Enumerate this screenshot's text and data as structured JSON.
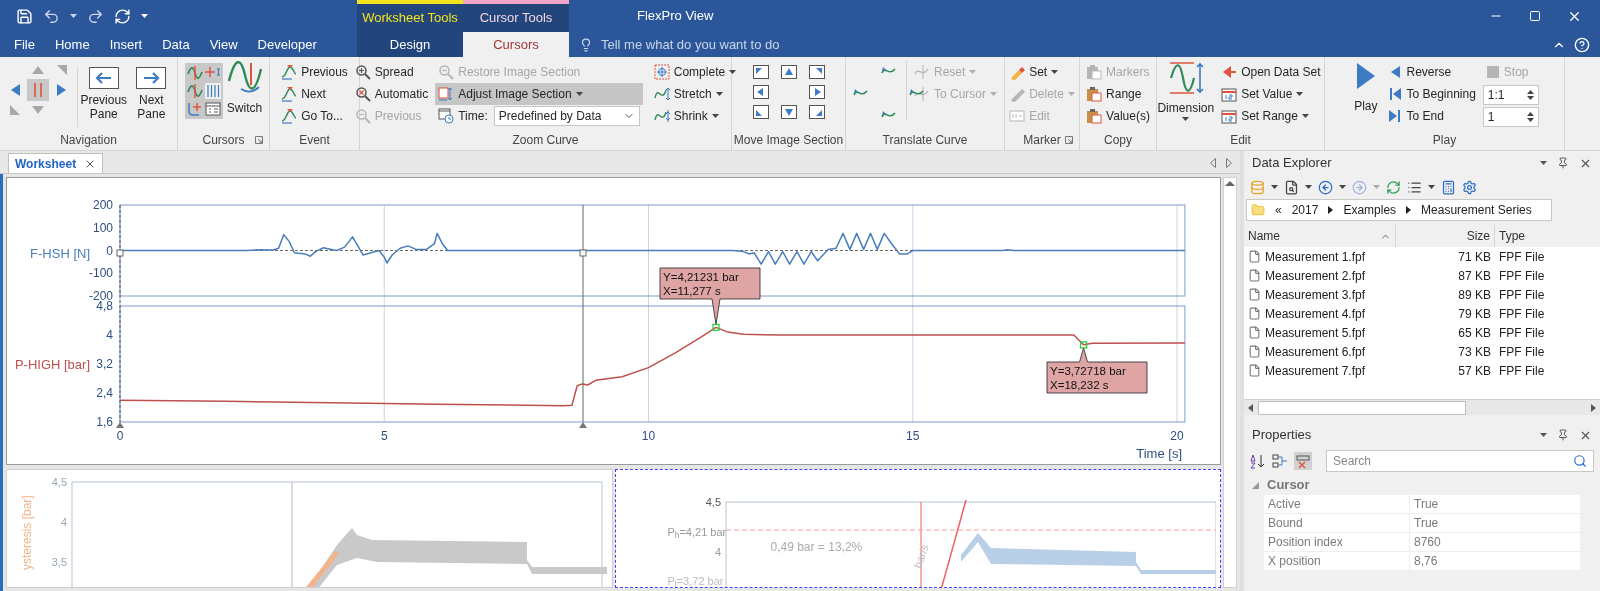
{
  "title_bar": {
    "title": "FlexPro View"
  },
  "menu_tabs": [
    {
      "label": "File",
      "selected": false
    },
    {
      "label": "Home",
      "selected": false
    },
    {
      "label": "Insert",
      "selected": false
    },
    {
      "label": "Data",
      "selected": false
    },
    {
      "label": "View",
      "selected": false
    },
    {
      "label": "Developer",
      "selected": false
    }
  ],
  "context_groups": [
    {
      "label": "Worksheet Tools",
      "color": "#f4e31c",
      "tabs": [
        {
          "label": "Design",
          "selected": false
        }
      ]
    },
    {
      "label": "Cursor Tools",
      "color": "#f2a5c6",
      "tabs": [
        {
          "label": "Cursors",
          "selected": true
        }
      ]
    }
  ],
  "tell_me": {
    "placeholder": "Tell me what do you want to do"
  },
  "ribbon": {
    "navigation": {
      "label": "Navigation",
      "buttons": [
        {
          "label": "Previous Pane"
        },
        {
          "label": "Next Pane"
        }
      ]
    },
    "cursors": {
      "label": "Cursors",
      "switch": "Switch"
    },
    "event": {
      "label": "Event",
      "items": [
        {
          "label": "Previous"
        },
        {
          "label": "Next"
        },
        {
          "label": "Go To..."
        }
      ]
    },
    "zoom": {
      "label": "Zoom Curve",
      "items": [
        {
          "label": "Spread",
          "disabled": false
        },
        {
          "label": "Automatic",
          "disabled": false
        },
        {
          "label": "Previous",
          "disabled": true
        }
      ],
      "image": [
        {
          "label": "Restore Image Section",
          "disabled": true,
          "dropdown": false,
          "selected": false
        },
        {
          "label": "Adjust Image Section",
          "disabled": false,
          "dropdown": true,
          "selected": true
        }
      ],
      "time": {
        "label": "Time:",
        "value": "Predefined by Data"
      },
      "fit": [
        {
          "label": "Complete",
          "dropdown": true
        },
        {
          "label": "Stretch",
          "dropdown": true
        },
        {
          "label": "Shrink",
          "dropdown": true
        }
      ]
    },
    "move": {
      "label": "Move Image Section"
    },
    "translate": {
      "label": "Translate Curve",
      "items": [
        {
          "label": "Reset",
          "disabled": true,
          "dropdown": true
        },
        {
          "label": "To Cursor",
          "disabled": true,
          "dropdown": true
        }
      ]
    },
    "marker": {
      "label": "Marker",
      "items": [
        {
          "label": "Set",
          "disabled": false,
          "dropdown": true
        },
        {
          "label": "Delete",
          "disabled": true,
          "dropdown": true
        },
        {
          "label": "Edit",
          "disabled": true,
          "dropdown": false
        }
      ]
    },
    "copy": {
      "label": "Copy",
      "items": [
        {
          "label": "Markers",
          "disabled": true
        },
        {
          "label": "Range",
          "disabled": false
        },
        {
          "label": "Value(s)",
          "disabled": false
        }
      ]
    },
    "edit": {
      "label": "Edit",
      "dimension": "Dimension",
      "items": [
        {
          "label": "Open Data Set",
          "dropdown": false
        },
        {
          "label": "Set Value",
          "dropdown": true
        },
        {
          "label": "Set Range",
          "dropdown": true
        }
      ]
    },
    "play": {
      "label": "Play",
      "play": "Play",
      "items": [
        {
          "label": "Reverse",
          "disabled": false
        },
        {
          "label": "To Beginning",
          "disabled": false
        },
        {
          "label": "To End",
          "disabled": false
        }
      ],
      "stop": {
        "label": "Stop",
        "disabled": true
      },
      "spinners": [
        {
          "value": "1:1"
        },
        {
          "value": "1"
        }
      ]
    }
  },
  "doc_tabs": [
    {
      "label": "Worksheet",
      "selected": true
    }
  ],
  "chart": {
    "panes": [
      {
        "chart_data": {
          "type": "line",
          "ylim": [
            -200,
            200
          ],
          "yticks": [
            200,
            100,
            0,
            -100,
            -200
          ],
          "xlim": [
            0,
            20.15
          ],
          "x": [
            0,
            2.4,
            2.6,
            2.9,
            3.0,
            3.1,
            3.2,
            3.3,
            3.5,
            3.6,
            3.7,
            3.85,
            4.0,
            4.1,
            4.25,
            4.4,
            4.5,
            4.6,
            4.75,
            4.9,
            5.0,
            5.05,
            5.15,
            5.3,
            5.45,
            5.6,
            5.8,
            5.95,
            6.0,
            6.1,
            6.2,
            11.6,
            11.8,
            11.9,
            12.0,
            12.13,
            12.27,
            12.4,
            12.54,
            12.67,
            12.81,
            12.94,
            13.08,
            13.2,
            13.4,
            13.55,
            13.68,
            13.81,
            13.94,
            14.07,
            14.2,
            14.33,
            14.46,
            14.6,
            14.75,
            14.9,
            15.0,
            16.7,
            16.8,
            16.9,
            20.15
          ],
          "series": [
            {
              "name": "F-HSH [N]",
              "color": "#4a7ebb",
              "values": [
                0,
                0,
                3,
                2,
                10,
                70,
                40,
                -10,
                -15,
                -25,
                -5,
                12,
                5,
                0,
                15,
                60,
                20,
                -20,
                -10,
                0,
                -30,
                -55,
                -20,
                10,
                20,
                5,
                5,
                30,
                75,
                30,
                0,
                0,
                -5,
                -15,
                -10,
                -60,
                -5,
                -60,
                -5,
                -60,
                -5,
                -60,
                -5,
                -45,
                5,
                10,
                75,
                5,
                75,
                5,
                75,
                5,
                75,
                30,
                -15,
                -15,
                0,
                0,
                3,
                0,
                0
              ]
            }
          ]
        }
      },
      {
        "chart_data": {
          "type": "line",
          "xlabel": "Time [s]",
          "ylim": [
            1.6,
            4.8
          ],
          "xlim": [
            0,
            20.15
          ],
          "yticks": [
            {
              "value": 4.8,
              "label": "4,8"
            },
            {
              "value": 4,
              "label": "4"
            },
            {
              "value": 3.2,
              "label": "3,2"
            },
            {
              "value": 2.4,
              "label": "2,4"
            },
            {
              "value": 1.6,
              "label": "1,6"
            }
          ],
          "xticks": [
            0,
            5,
            10,
            15,
            20
          ],
          "x": [
            0,
            2,
            4,
            6,
            8.4,
            8.55,
            8.65,
            8.75,
            8.85,
            9.0,
            9.5,
            10,
            10.5,
            11.0,
            11.277,
            11.5,
            11.8,
            12.5,
            18.05,
            18.23,
            18.4,
            20.15
          ],
          "series": [
            {
              "name": "P-HIGH [bar]",
              "color": "#c0504d",
              "values": [
                2.2,
                2.17,
                2.13,
                2.09,
                2.05,
                2.06,
                2.6,
                2.65,
                2.62,
                2.75,
                2.85,
                3.1,
                3.5,
                3.95,
                4.21,
                4.08,
                4.02,
                4.0,
                4.0,
                3.73,
                3.77,
                3.78
              ]
            }
          ]
        }
      }
    ],
    "callouts": [
      {
        "lines": [
          "Y=4,21231 bar",
          "X=11,277 s"
        ]
      },
      {
        "lines": [
          "Y=3,72718 bar",
          "X=18,232 s"
        ]
      }
    ]
  },
  "lower_charts": [
    {
      "selected": false,
      "ylabel": "ysteresis [bar]",
      "yticks": [
        "4,5",
        "4",
        "3,5"
      ]
    },
    {
      "selected": true,
      "yticks": [
        "4,5",
        "4"
      ],
      "annotations": [
        "P$_{h}$=4,21 bar",
        "0,49 bar = 13,2%",
        "P$_{l}$=3,72 bar",
        "bar/s"
      ]
    }
  ],
  "data_explorer": {
    "title": "Data Explorer",
    "path": [
      "«",
      "2017",
      "Examples",
      "Measurement Series"
    ],
    "columns": [
      "Name",
      "Size",
      "Type"
    ],
    "rows": [
      {
        "name": "Measurement 1.fpf",
        "size": "71 KB",
        "type": "FPF File"
      },
      {
        "name": "Measurement 2.fpf",
        "size": "87 KB",
        "type": "FPF File"
      },
      {
        "name": "Measurement 3.fpf",
        "size": "89 KB",
        "type": "FPF File"
      },
      {
        "name": "Measurement 4.fpf",
        "size": "79 KB",
        "type": "FPF File"
      },
      {
        "name": "Measurement 5.fpf",
        "size": "65 KB",
        "type": "FPF File"
      },
      {
        "name": "Measurement 6.fpf",
        "size": "73 KB",
        "type": "FPF File"
      },
      {
        "name": "Measurement 7.fpf",
        "size": "57 KB",
        "type": "FPF File"
      }
    ]
  },
  "properties": {
    "title": "Properties",
    "search": {
      "placeholder": "Search"
    },
    "group": "Cursor",
    "rows": [
      {
        "name": "Active",
        "value": "True"
      },
      {
        "name": "Bound",
        "value": "True"
      },
      {
        "name": "Position index",
        "value": "8760"
      },
      {
        "name": "X position",
        "value": "8,76"
      }
    ]
  }
}
